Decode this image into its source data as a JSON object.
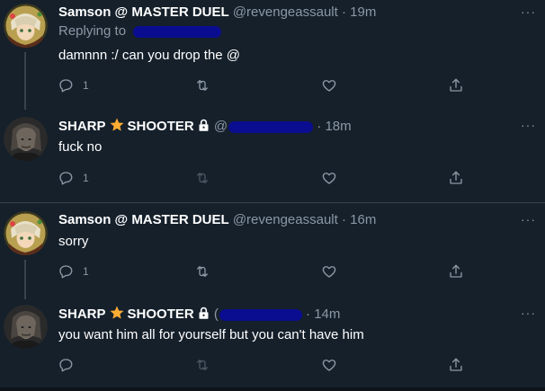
{
  "tweets": [
    {
      "display_name": "Samson @ MASTER DUEL",
      "handle": "@revengeassault",
      "dot": "·",
      "time": "19m",
      "replying_label": "Replying to",
      "text": "damnnn :/ can you drop the @",
      "reply_count": "1",
      "retweet_count": "",
      "avatar": "anime-avatar"
    },
    {
      "name_part1": "SHARP",
      "name_part2": "SHOOTER",
      "handle_prefix": "@",
      "dot": "·",
      "time": "18m",
      "text": "fuck no",
      "reply_count": "1",
      "avatar": "dark-portrait-avatar"
    },
    {
      "display_name": "Samson @ MASTER DUEL",
      "handle": "@revengeassault",
      "dot": "·",
      "time": "16m",
      "text": "sorry",
      "reply_count": "1",
      "avatar": "anime-avatar"
    },
    {
      "name_part1": "SHARP",
      "name_part2": "SHOOTER",
      "handle_prefix": "(",
      "dot": "·",
      "time": "14m",
      "text": "you want him all for yourself but you can't have him",
      "reply_count": "",
      "avatar": "dark-portrait-avatar"
    }
  ],
  "more_label": "···",
  "colors": {
    "background": "#15202b",
    "muted": "#8b98a5",
    "text": "#ffffff",
    "redaction": "#0a0d8f",
    "star": "#ffac33"
  },
  "icons": [
    "reply-icon",
    "retweet-icon",
    "like-icon",
    "share-icon",
    "star-icon",
    "lock-icon",
    "more-icon"
  ]
}
